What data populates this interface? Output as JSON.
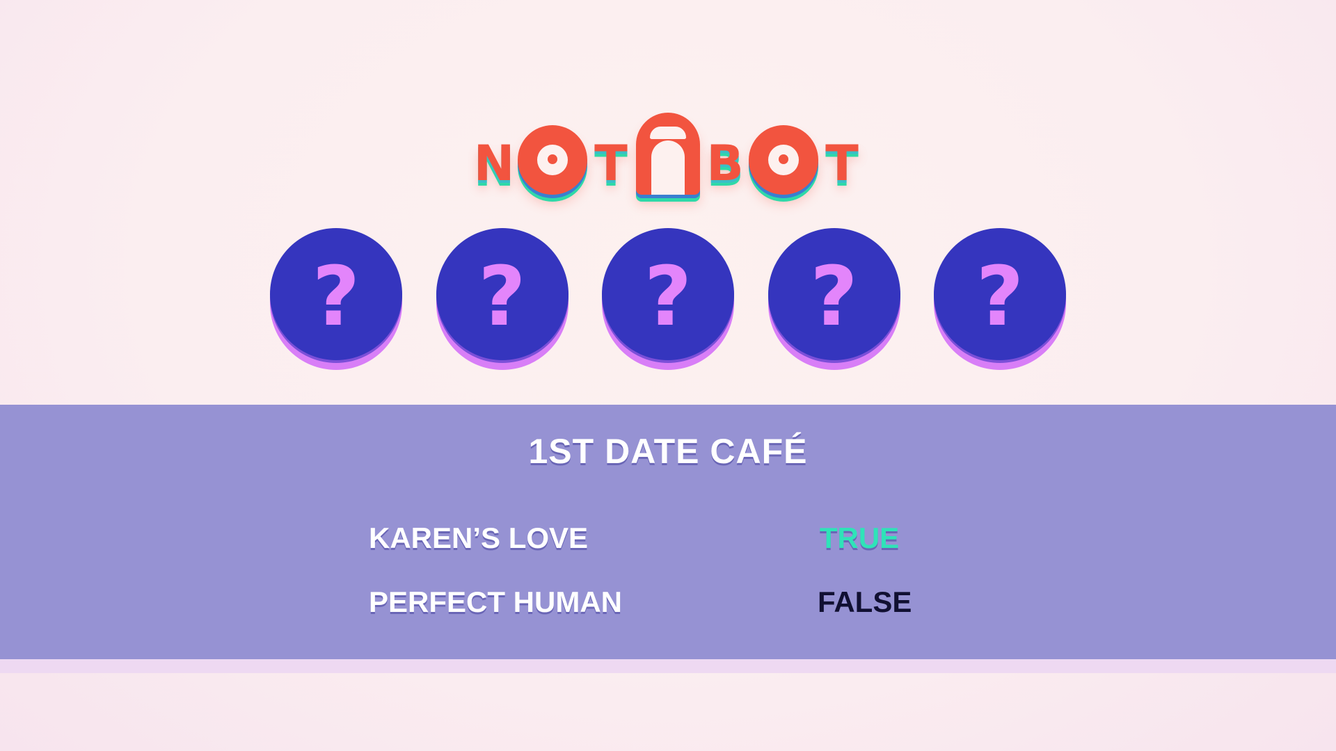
{
  "logo": {
    "text": "NOTABOT",
    "letters": [
      "N",
      "O",
      "T",
      "A",
      "B",
      "O",
      "T"
    ]
  },
  "tokens": [
    {
      "symbol": "?",
      "icon": "question-mark-icon"
    },
    {
      "symbol": "?",
      "icon": "question-mark-icon"
    },
    {
      "symbol": "?",
      "icon": "question-mark-icon"
    },
    {
      "symbol": "?",
      "icon": "question-mark-icon"
    },
    {
      "symbol": "?",
      "icon": "question-mark-icon"
    }
  ],
  "results": {
    "title": "1ST DATE CAFÉ",
    "rows": [
      {
        "label": "KAREN’S LOVE",
        "value": "TRUE",
        "status": "true"
      },
      {
        "label": "PERFECT HUMAN",
        "value": "FALSE",
        "status": "false"
      }
    ]
  },
  "colors": {
    "background": "#fbeef0",
    "logo_red": "#f2543f",
    "logo_blue": "#3a7fd0",
    "logo_green": "#2fd9a8",
    "token_face": "#3535be",
    "token_symbol": "#e385fb",
    "token_rim": "#d87ef7",
    "panel": "#9692d3",
    "true_color": "#2fe3b8",
    "false_color": "#111032"
  }
}
